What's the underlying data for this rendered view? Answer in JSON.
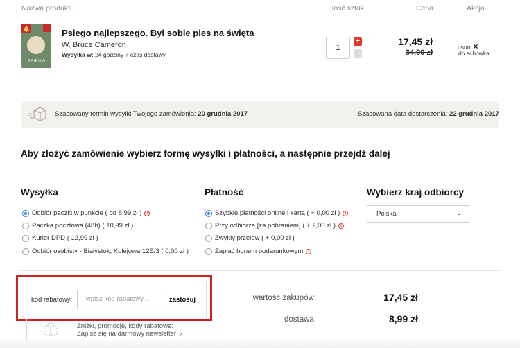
{
  "table_header": {
    "product": "Nazwa produktu",
    "quantity": "Ilość sztuk",
    "price": "Cena",
    "action": "Akcja"
  },
  "product": {
    "title": "Psiego najlepszego. Był sobie pies na święta",
    "author": "W. Bruce Cameron",
    "shipping_label": "Wysyłka w:",
    "shipping_value": "24 godziny + czas dostawy",
    "cover_text": "PSIEGO",
    "quantity": "1",
    "price": "17,45 zł",
    "old_price": "34,90 zł",
    "remove_label": "usuń",
    "save_label": "do schowka"
  },
  "delivery_band": {
    "shipping_estimate_label": "Szacowany termin wysyłki Twojego zamówienia:",
    "shipping_estimate_date": "20 grudnia 2017",
    "delivery_estimate_label": "Szacowana data dostarczenia:",
    "delivery_estimate_date": "22 grudnia 2017"
  },
  "instructions": "Aby złożyć zamówienie wybierz formę wysyłki i płatności, a następnie przejdź dalej",
  "shipping": {
    "title": "Wysyłka",
    "options": [
      {
        "label": "Odbiór paczki w punkcie",
        "price": "( od 8,99 zł )",
        "selected": true
      },
      {
        "label": "Paczka pocztowa (48h)",
        "price": "( 10,99 zł )",
        "selected": false
      },
      {
        "label": "Kurier DPD",
        "price": "( 12,99 zł )",
        "selected": false
      },
      {
        "label": "Odbiór osobisty - Białystok, Kolejowa 12E/3",
        "price": "( 0,00 zł )",
        "selected": false
      }
    ]
  },
  "payment": {
    "title": "Płatność",
    "options": [
      {
        "label": "Szybkie płatności online i kartą",
        "price": "( + 0,00 zł )",
        "selected": true
      },
      {
        "label": "Przy odbiorze [za pobraniem]",
        "price": "( + 2,00 zł )",
        "selected": false
      },
      {
        "label": "Zwykły przelew",
        "price": "( + 0,00 zł )",
        "selected": false
      },
      {
        "label": "Zapłać bonem podarunkowym",
        "price": "",
        "selected": false
      }
    ]
  },
  "country": {
    "title": "Wybierz kraj odbiorcy",
    "selected": "Polska"
  },
  "discount": {
    "label": "kod rabatowy:",
    "placeholder": "wpisz kod rabatowy...",
    "apply": "zastosuj"
  },
  "promo": {
    "line1": "Zniżki, promocje, kody rabatowe:",
    "line2": "Zapisz się na darmowy newsletter"
  },
  "summary": {
    "purchase_label": "wartość zakupów:",
    "purchase_value": "17,45 zł",
    "delivery_label": "dostawa:",
    "delivery_value": "8,99 zł"
  },
  "colors": {
    "accent_red": "#e03a2f",
    "radio_blue": "#2f7de1",
    "highlight_border": "#cc2222"
  }
}
